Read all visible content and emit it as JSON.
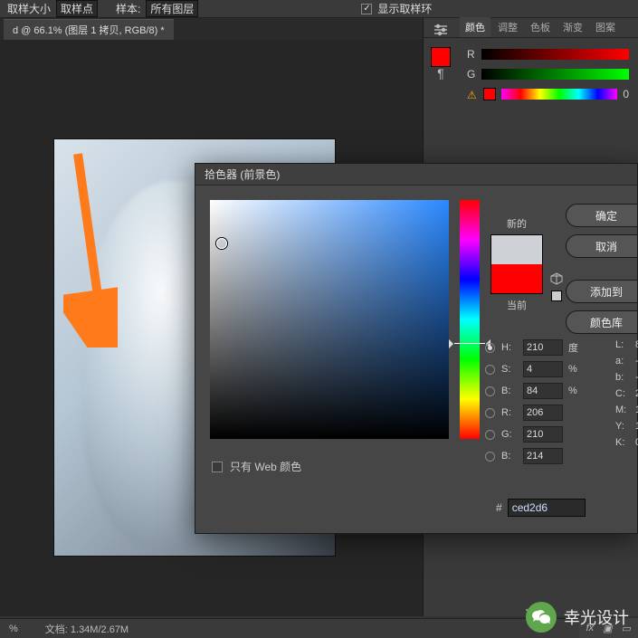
{
  "topbar": {
    "sample_size_label": "取样大小",
    "sample_size_value": "取样点",
    "sample_label": "样本:",
    "sample_value": "所有图层",
    "show_ring_label": "显示取样环"
  },
  "doc_tab": "d @ 66.1% (图层 1 拷贝, RGB/8) *",
  "right_panel": {
    "tabs": [
      "颜色",
      "调整",
      "色板",
      "渐变",
      "图案"
    ],
    "sliders": {
      "r": "R",
      "g": "G"
    },
    "val0": "0",
    "glyph_toggle": "A|"
  },
  "picker": {
    "title": "拾色器 (前景色)",
    "new_label": "新的",
    "current_label": "当前",
    "btn_ok": "确定",
    "btn_cancel": "取消",
    "btn_add": "添加到",
    "btn_libs": "颜色库",
    "webonly_label": "只有 Web 颜色",
    "vals": {
      "H": {
        "label": "H:",
        "val": "210",
        "unit": "度"
      },
      "S": {
        "label": "S:",
        "val": "4",
        "unit": "%"
      },
      "Bv": {
        "label": "B:",
        "val": "84",
        "unit": "%"
      },
      "R": {
        "label": "R:",
        "val": "206"
      },
      "G": {
        "label": "G:",
        "val": "210"
      },
      "B": {
        "label": "B:",
        "val": "214"
      },
      "L": {
        "label": "L:",
        "val": "8"
      },
      "a": {
        "label": "a:",
        "val": "-"
      },
      "b": {
        "label": "b:",
        "val": "-"
      },
      "C": {
        "label": "C:",
        "val": "2"
      },
      "M": {
        "label": "M:",
        "val": "1"
      },
      "Y": {
        "label": "Y:",
        "val": "1"
      },
      "K": {
        "label": "K:",
        "val": "0"
      }
    },
    "hex_prefix": "#",
    "hex": "ced2d6"
  },
  "statusbar": {
    "zoom": "%",
    "docsize": "文档: 1.34M/2.67M"
  },
  "watermark": {
    "name": "幸光设计"
  },
  "bottom_icons": "fx"
}
